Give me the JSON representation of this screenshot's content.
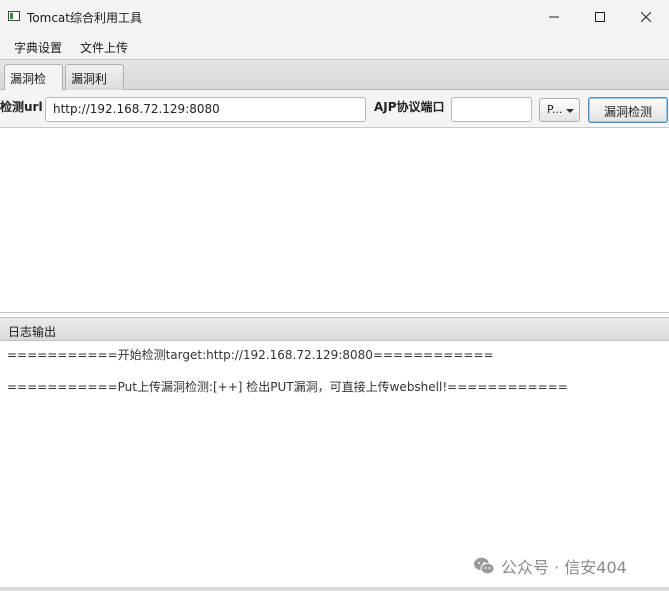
{
  "window": {
    "title": "Tomcat综合利用工具",
    "minimize_icon": "minimize-icon",
    "maximize_icon": "maximize-icon",
    "close_icon": "close-icon"
  },
  "menu": {
    "items": [
      "字典设置",
      "文件上传"
    ]
  },
  "tabs": [
    {
      "label": "漏洞检测",
      "active": true
    },
    {
      "label": "漏洞利用",
      "active": false
    }
  ],
  "form": {
    "url_label": "检测url",
    "url_value": "http://192.168.72.129:8080",
    "ajp_label": "AJP协议端口",
    "ajp_value": "",
    "combo_value": "P...",
    "detect_button": "漏洞检测"
  },
  "log": {
    "header": "日志输出",
    "lines": [
      "===========开始检测target:http://192.168.72.129:8080============",
      "===========Put上传漏洞检测:[++] 检出PUT漏洞，可直接上传webshell!============"
    ]
  },
  "watermark": {
    "text": "公众号 · 信安404",
    "icon": "wechat-icon"
  },
  "colors": {
    "accent": "#4a90c8",
    "titlebar_bg": "#f3f3f3"
  }
}
